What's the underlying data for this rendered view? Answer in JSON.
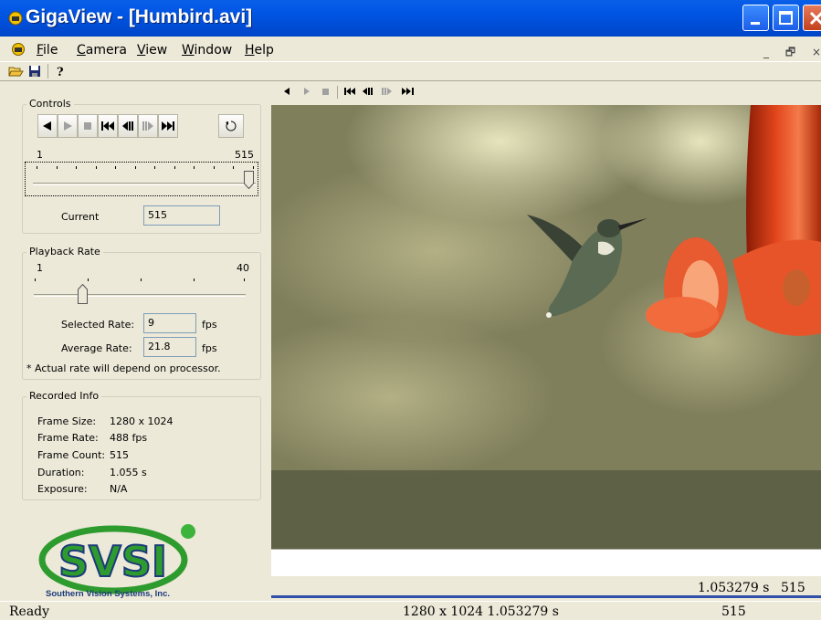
{
  "window": {
    "title": "GigaView - [Humbird.avi]"
  },
  "menu": {
    "items": [
      "File",
      "Camera",
      "View",
      "Window",
      "Help"
    ],
    "mdi_min": "_",
    "mdi_restore": "б",
    "mdi_close": "×"
  },
  "toolbar": {
    "icons": [
      "open-folder-icon",
      "save-disk-icon",
      "help-question-icon"
    ]
  },
  "controls": {
    "title": "Controls",
    "range_min": "1",
    "range_max": "515",
    "current_label": "Current",
    "current_value": "515",
    "position_fraction": 1.0
  },
  "playback": {
    "title": "Playback Rate",
    "range_min": "1",
    "range_max": "40",
    "selected_label": "Selected Rate:",
    "selected_value": "9",
    "average_label": "Average Rate:",
    "average_value": "21.8",
    "unit": "fps",
    "note": "* Actual rate will depend on processor."
  },
  "recorded": {
    "title": "Recorded Info",
    "rows": [
      {
        "key": "Frame Size:",
        "value": "1280 x 1024"
      },
      {
        "key": "Frame Rate:",
        "value": "488 fps"
      },
      {
        "key": "Frame Count:",
        "value": "515"
      },
      {
        "key": "Duration:",
        "value": "1.055 s"
      },
      {
        "key": "Exposure:",
        "value": "N/A"
      }
    ]
  },
  "logo": {
    "text": "SVSI",
    "tagline": "Southern Vision Systems, Inc."
  },
  "video_status": {
    "time": "1.053279 s",
    "frame": "515"
  },
  "status": {
    "ready": "Ready",
    "info": "1280 x 1024 1.053279 s",
    "frame": "515"
  },
  "colors": {
    "titlebar": "#0054E3",
    "face": "#ECE9D8",
    "logo_green": "#2E9B2E",
    "logo_navy": "#1C3A7A",
    "feeder_red": "#E84820"
  }
}
